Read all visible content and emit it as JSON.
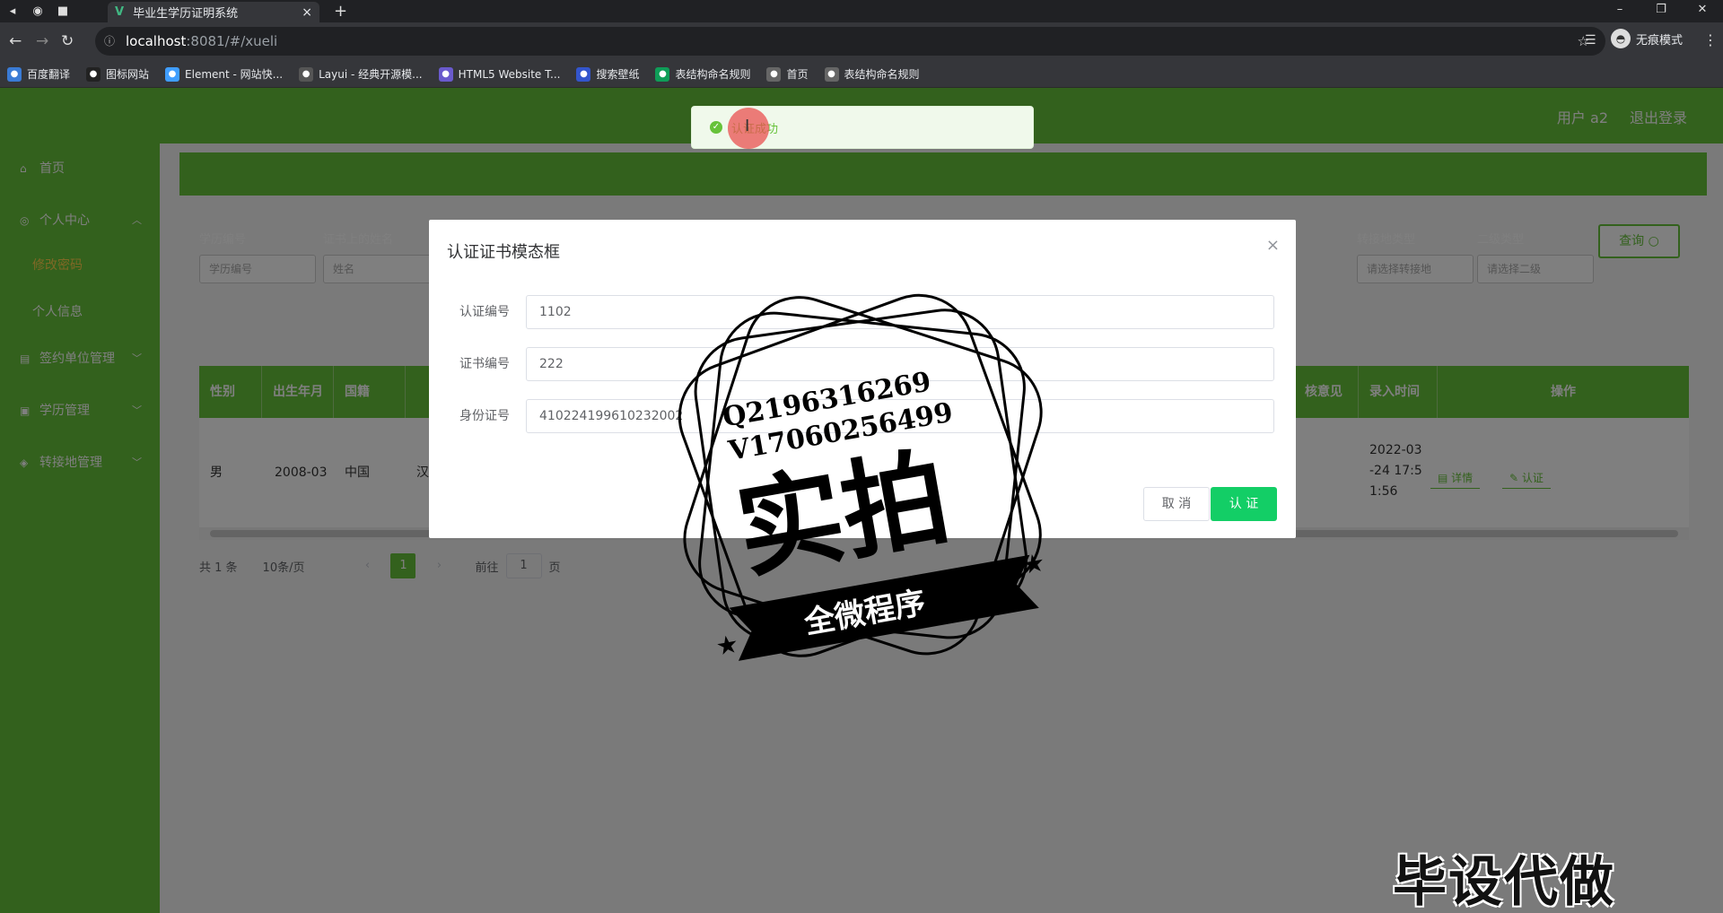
{
  "browser": {
    "tab_title": "毕业生学历证明系统",
    "url_host": "localhost",
    "url_rest": ":8081/#/xueli",
    "incognito_label": "无痕模式",
    "bookmarks": [
      {
        "label": "百度翻译",
        "icon": "translate-icon",
        "color": "#3a7bd5"
      },
      {
        "label": "图标网站",
        "icon": "flag-icon",
        "color": "#222"
      },
      {
        "label": "Element - 网站快...",
        "icon": "element-icon",
        "color": "#409eff"
      },
      {
        "label": "Layui - 经典开源模...",
        "icon": "layui-icon",
        "color": "#555"
      },
      {
        "label": "HTML5 Website T...",
        "icon": "html5-icon",
        "color": "#6a5acd"
      },
      {
        "label": "搜索壁纸",
        "icon": "wallpaper-icon",
        "color": "#3355cc"
      },
      {
        "label": "表结构命名规则",
        "icon": "sheet-icon",
        "color": "#0f9d58"
      },
      {
        "label": "首页",
        "icon": "globe-icon",
        "color": "#666"
      },
      {
        "label": "表结构命名规则",
        "icon": "globe-icon",
        "color": "#666"
      }
    ]
  },
  "header": {
    "user_label": "用户 a2",
    "logout_label": "退出登录"
  },
  "sidebar": {
    "items": [
      {
        "label": "首页"
      },
      {
        "label": "个人中心"
      },
      {
        "label": "修改密码"
      },
      {
        "label": "个人信息"
      },
      {
        "label": "签约单位管理"
      },
      {
        "label": "学历管理"
      },
      {
        "label": "转接地管理"
      }
    ]
  },
  "filters": {
    "items": [
      {
        "label": "学历编号",
        "placeholder": "学历编号"
      },
      {
        "label": "证书上的姓名",
        "placeholder": "姓名"
      },
      {
        "label": "转接地类型",
        "placeholder": "请选择转接地"
      },
      {
        "label": "二级类型",
        "placeholder": "请选择二级"
      }
    ],
    "query_label": "查询"
  },
  "table": {
    "headers": {
      "gender": "性别",
      "birth": "出生年月",
      "nation": "国籍",
      "review": "核意见",
      "time": "录入时间",
      "ops": "操作"
    },
    "row": {
      "gender": "男",
      "birth": "2008-03",
      "nation": "中国",
      "ethnic": "汉",
      "time": "2022-03 -24 17:5 1:56",
      "detail_label": "详情",
      "certify_label": "认证"
    }
  },
  "pager": {
    "total": "共 1 条",
    "page_size": "10条/页",
    "current": "1",
    "goto_label": "前往",
    "goto_value": "1",
    "page_unit": "页"
  },
  "toast": {
    "message": "认证成功"
  },
  "modal": {
    "title": "认证证书模态框",
    "fields": [
      {
        "label": "认证编号",
        "value": "1102"
      },
      {
        "label": "证书编号",
        "value": "222"
      },
      {
        "label": "身份证号",
        "value": "410224199610232002"
      }
    ],
    "cancel_label": "取 消",
    "ok_label": "认 证"
  },
  "watermark": {
    "contact_q": "Q2196316269",
    "contact_v": "V17060256499",
    "big_text": "实拍",
    "ribbon_text": "全微程序",
    "bottom_text": "毕设代做"
  },
  "colors": {
    "brand_green": "#67c23a",
    "confirm_green": "#13ce66"
  }
}
